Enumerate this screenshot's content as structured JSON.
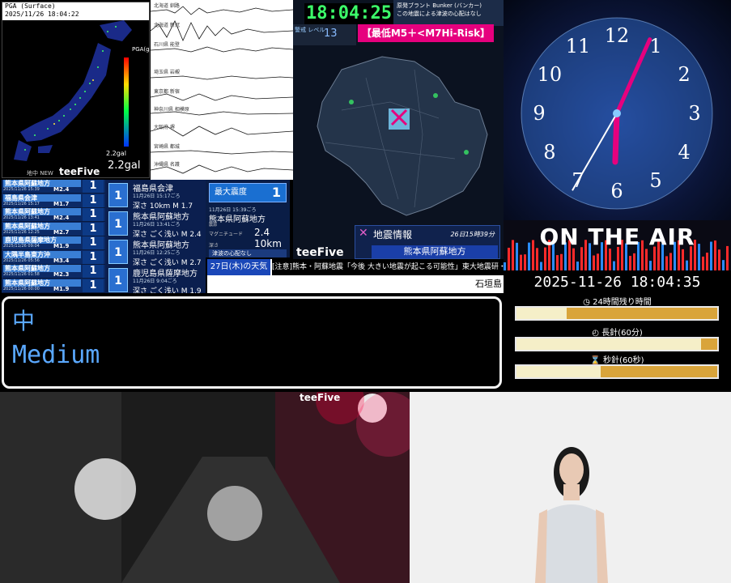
{
  "pga": {
    "title": "PGA (Surface)",
    "datetime": "2025/11/26 18:04:22",
    "scale_label": "PGA(gal)",
    "gal_small": "2.2gal",
    "gal": "2.2gal",
    "footer": "地中 NEW",
    "brand": "teeFive"
  },
  "seismo": {
    "stations": [
      "北海道 釧路",
      "北海道 新冠",
      "石川県 能登",
      "埼玉県 岩槻",
      "東京都 新宿",
      "神奈川県 相模原",
      "大阪府 堺",
      "宮崎県 都城",
      "沖縄県 名護"
    ]
  },
  "center": {
    "clock": "18:04:25",
    "bunker_line1": "原発ブラント Bunker (バンカー)",
    "bunker_line2": "この地震による津波の心配はなし",
    "level_label": "警戒 レベル",
    "level_value": "13",
    "risk": "【最低M5＋<M7Hi-Risk】",
    "eq_title": "地震情報",
    "eq_date": "26日15時39分",
    "eq_location": "熊本県阿蘇地方",
    "brand": "teeFive"
  },
  "quake_list": [
    {
      "loc": "熊本県阿蘇地方",
      "time": "2025/11/26 15:39",
      "mag": "M2.4",
      "int": "1"
    },
    {
      "loc": "福島県会津",
      "time": "2025/11/26 15:17",
      "mag": "M1.7",
      "int": "1"
    },
    {
      "loc": "熊本県阿蘇地方",
      "time": "2025/11/26 13:41",
      "mag": "M2.4",
      "int": "1"
    },
    {
      "loc": "熊本県阿蘇地方",
      "time": "2025/11/26 12:25",
      "mag": "M2.7",
      "int": "1"
    },
    {
      "loc": "鹿児島県薩摩地方",
      "time": "2025/11/26 09:04",
      "mag": "M1.9",
      "int": "1"
    },
    {
      "loc": "大隅半島東方沖",
      "time": "2025/11/26 05:56",
      "mag": "M3.4",
      "int": "1"
    },
    {
      "loc": "熊本県阿蘇地方",
      "time": "2025/11/26 01:58",
      "mag": "M2.3",
      "int": "1"
    },
    {
      "loc": "熊本県阿蘇地方",
      "time": "2025/11/26 00:00",
      "mag": "M1.9",
      "int": "1"
    }
  ],
  "quake_detail": [
    {
      "int": "1",
      "loc": "福島県会津",
      "time": "11月26日 15:17ごろ",
      "mag": "深さ 10km  M 1.7"
    },
    {
      "int": "1",
      "loc": "熊本県阿蘇地方",
      "time": "11月26日 13:41ごろ",
      "mag": "深さ ごく浅い  M 2.4"
    },
    {
      "int": "1",
      "loc": "熊本県阿蘇地方",
      "time": "11月26日 12:25ごろ",
      "mag": "深さ ごく浅い  M 2.7"
    },
    {
      "int": "1",
      "loc": "鹿児島県薩摩地方",
      "time": "11月26日 9:04ごろ",
      "mag": "深さ ごく浅い  M 1.9"
    }
  ],
  "max_intensity": {
    "label": "最大震度",
    "value": "1",
    "time": "11月26日 15:39ごろ",
    "loc": "熊本県阿蘇地方",
    "note": "震源",
    "mag_label": "マグニチュード",
    "mag_value": "2.4",
    "depth_label": "深さ",
    "depth_value": "10km",
    "tsunami": "津波の心配なし"
  },
  "ticker": {
    "weather": "27日(木)の天気",
    "news": "[注意]熊本・阿蘇地震「今後 大きい地震が起こる可能性」東大地震研・笠原教授",
    "city": "石垣島"
  },
  "clock_face": {
    "numbers": [
      "12",
      "1",
      "2",
      "3",
      "4",
      "5",
      "6",
      "7",
      "8",
      "9",
      "10",
      "11"
    ],
    "hour": 6,
    "minute": 4,
    "second": 35
  },
  "onair": {
    "text": "ON THE AIR"
  },
  "datetime_panel": {
    "datetime": "2025-11-26 18:04:35",
    "progress": [
      {
        "label": "24時間残り時間",
        "icon": "clock-icon",
        "value": 0.25
      },
      {
        "label": "長針(60分)",
        "icon": "clock-icon",
        "value": 0.92
      },
      {
        "label": "秒針(60秒)",
        "icon": "hourglass-icon",
        "value": 0.42
      }
    ]
  },
  "medium": {
    "kanji": "中",
    "en": "Medium"
  },
  "camera": {
    "brand": "teeFive"
  },
  "colors": {
    "accent_green": "#3cff6a",
    "risk_pink": "#e6007e",
    "medium_blue": "#5aa8ff",
    "progress_gold": "#d9a43a"
  }
}
